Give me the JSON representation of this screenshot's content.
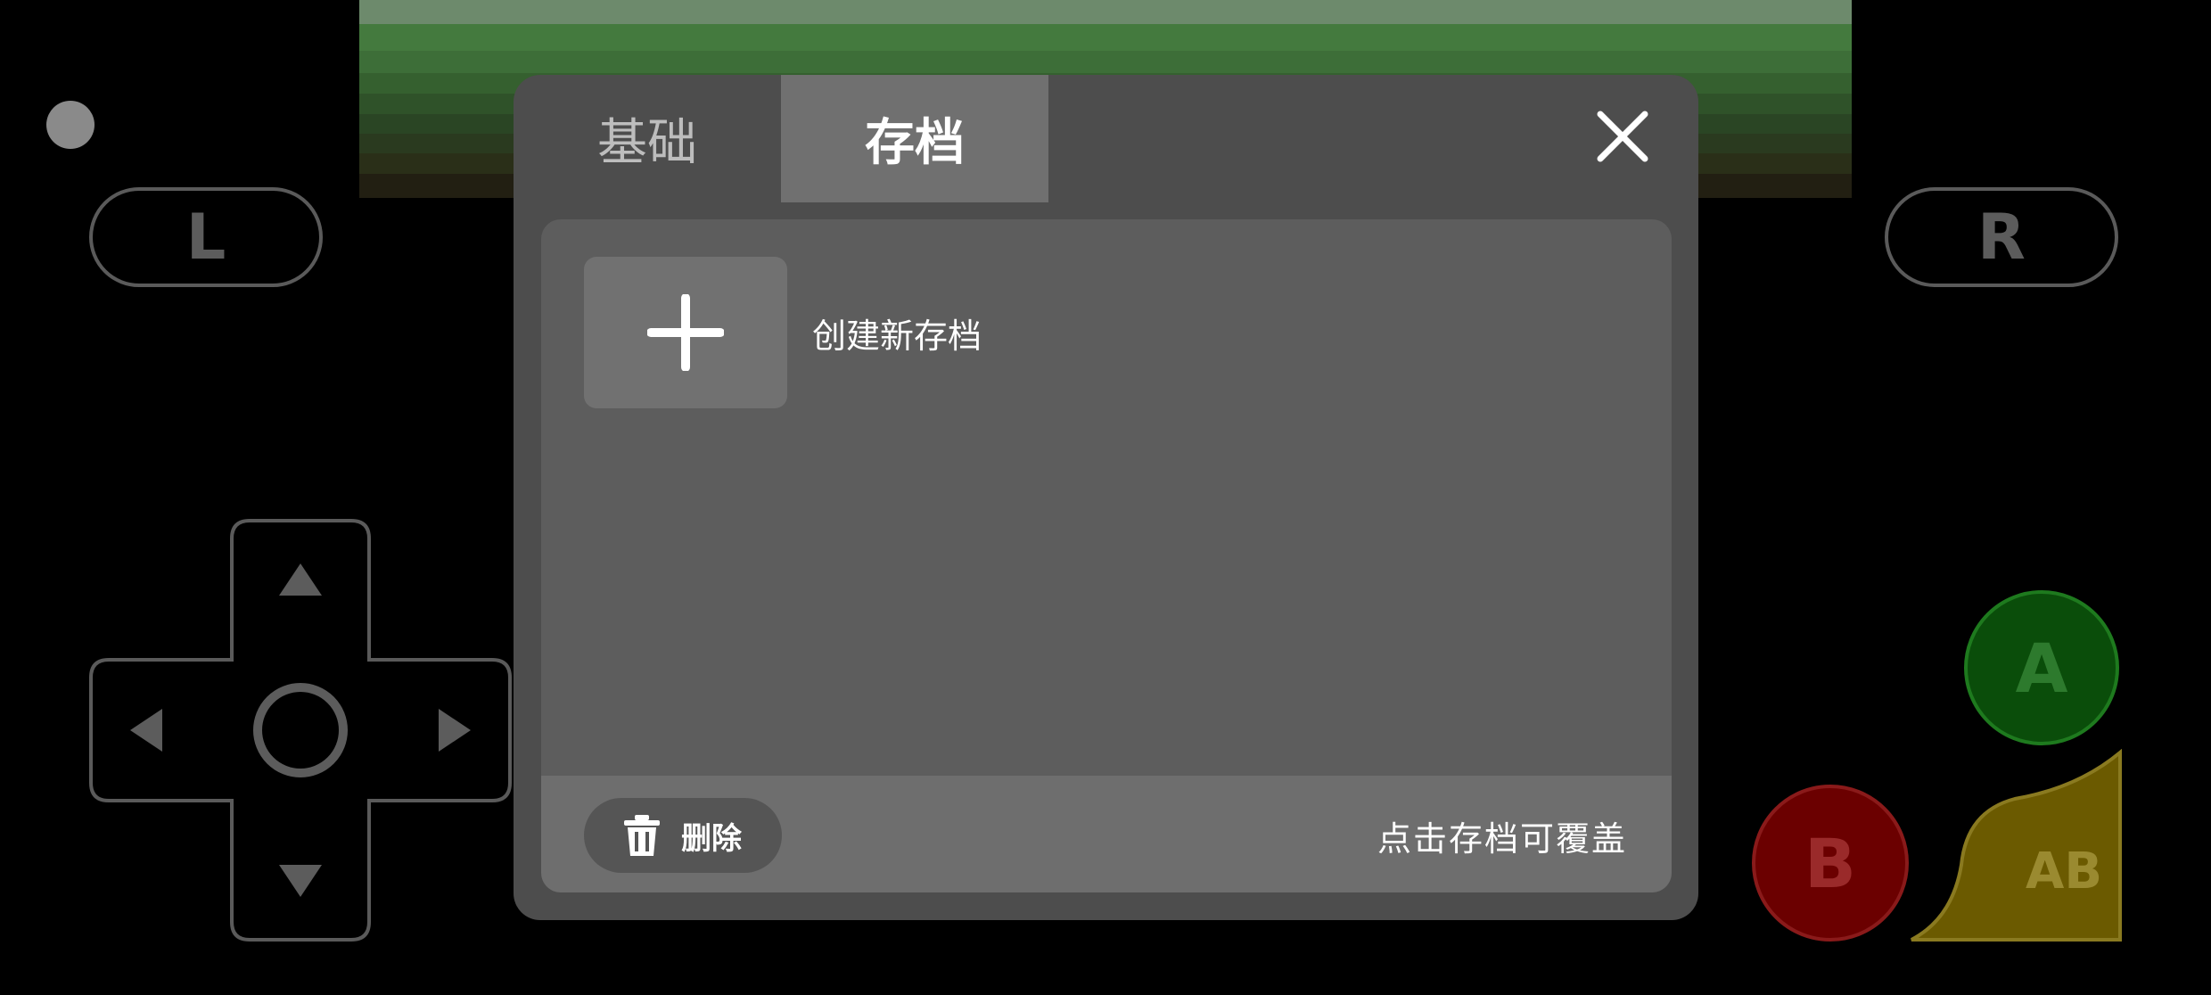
{
  "controls": {
    "shoulder_left": "L",
    "shoulder_right": "R",
    "button_a": "A",
    "button_b": "B",
    "button_ab": "AB",
    "dpad_icons": [
      "arrow-up-icon",
      "arrow-down-icon",
      "arrow-left-icon",
      "arrow-right-icon",
      "dpad-center-icon"
    ]
  },
  "modal": {
    "tabs": [
      {
        "label": "基础",
        "active": false
      },
      {
        "label": "存档",
        "active": true
      }
    ],
    "close_icon": "close-icon",
    "new_save_label": "创建新存档",
    "new_save_icon": "plus-icon",
    "delete_label": "删除",
    "delete_icon": "trash-icon",
    "hint": "点击存档可覆盖"
  },
  "colors": {
    "modal_bg": "#4d4d4d",
    "active_tab": "#707070",
    "panel_bg": "#5d5d5d",
    "button_a": "#0a4d0a",
    "button_b": "#6b0000",
    "button_ab": "#6b5a00"
  }
}
